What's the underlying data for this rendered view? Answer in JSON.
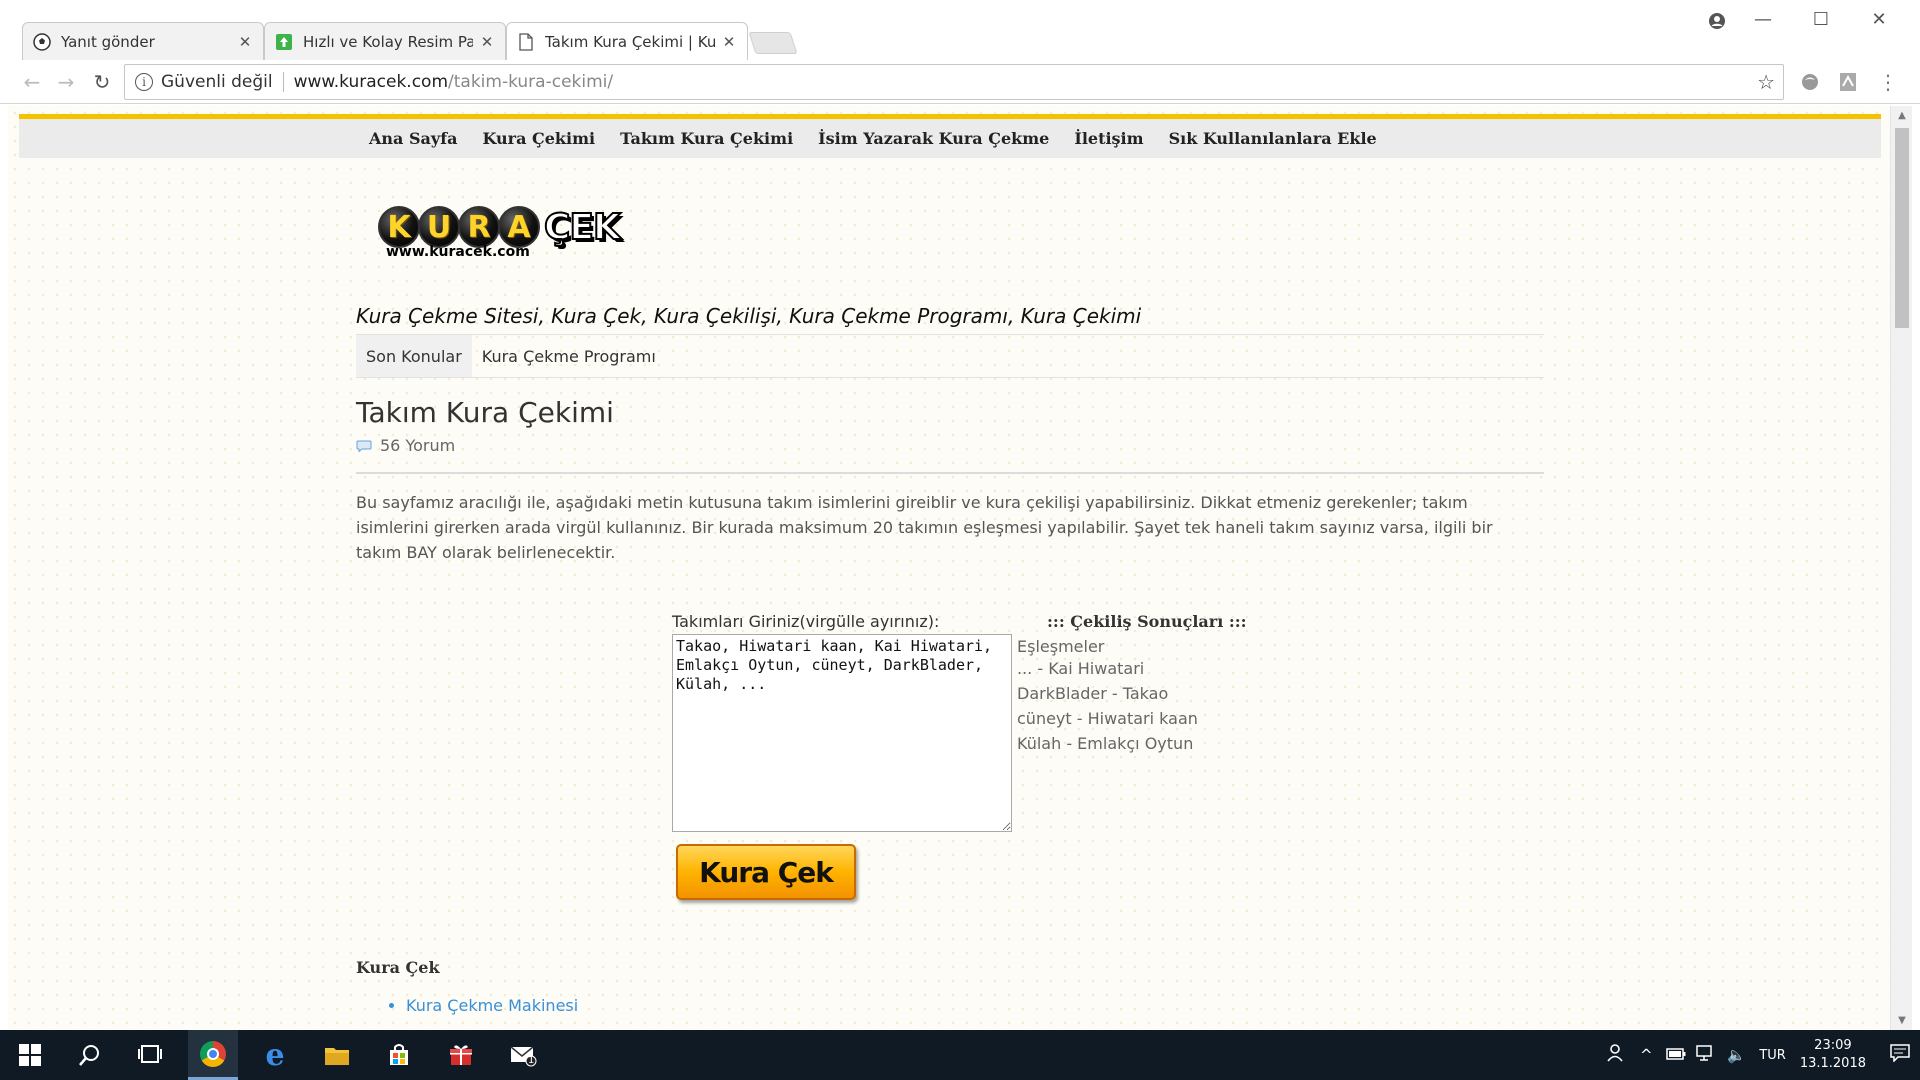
{
  "browser": {
    "tabs": [
      {
        "title": "Yanıt gönder",
        "icon": "soccer-ball-icon"
      },
      {
        "title": "Hızlı ve Kolay Resim Paylaşımı",
        "icon": "green-upload-icon"
      },
      {
        "title": "Takım Kura Çekimi | Kura Çek",
        "icon": "page-icon",
        "active": true
      }
    ],
    "security_label": "Güvenli değil",
    "url_host": "www.kuracek.com",
    "url_path": "/takim-kura-cekimi/"
  },
  "site": {
    "topnav": [
      "Ana Sayfa",
      "Kura Çekimi",
      "Takım Kura Çekimi",
      "İsim Yazarak Kura Çekme",
      "İletişim",
      "Sık Kullanılanlara Ekle"
    ],
    "logo": {
      "letters": [
        "K",
        "U",
        "R",
        "A"
      ],
      "suffix": "ÇEK",
      "url": "www.kuracek.com"
    },
    "tagline": "Kura Çekme Sitesi, Kura Çek, Kura Çekilişi, Kura Çekme Programı, Kura Çekimi",
    "subnav": [
      "Son Konular",
      "Kura Çekme Programı"
    ],
    "page_title": "Takım Kura Çekimi",
    "comments": "56 Yorum",
    "intro": "Bu sayfamız aracılığı ile, aşağıdaki metin kutusuna takım isimlerini gireiblir ve kura çekilişi yapabilirsiniz. Dikkat etmeniz gerekenler; takım isimlerini girerken arada virgül kullanınız. Bir kurada maksimum 20 takımın eşleşmesi yapılabilir. Şayet tek haneli takım sayınız varsa, ilgili bir takım BAY olarak belirlenecektir.",
    "form": {
      "label": "Takımları Giriniz(virgülle ayırınız):",
      "value": "Takao, Hiwatari kaan, Kai Hiwatari, Emlakçı Oytun, cüneyt, DarkBlader, Külah, ...",
      "button": "Kura Çek"
    },
    "results": {
      "title": "::: Çekiliş Sonuçları :::",
      "subtitle": "Eşleşmeler",
      "rows": [
        "... - Kai Hiwatari",
        "DarkBlader - Takao",
        "cüneyt - Hiwatari kaan",
        "Külah - Emlakçı Oytun"
      ]
    },
    "section_heading": "Kura Çek",
    "links": [
      "Kura Çekme Makinesi"
    ]
  },
  "taskbar": {
    "language": "TUR",
    "time": "23:09",
    "date": "13.1.2018",
    "mail_badge": "1"
  }
}
